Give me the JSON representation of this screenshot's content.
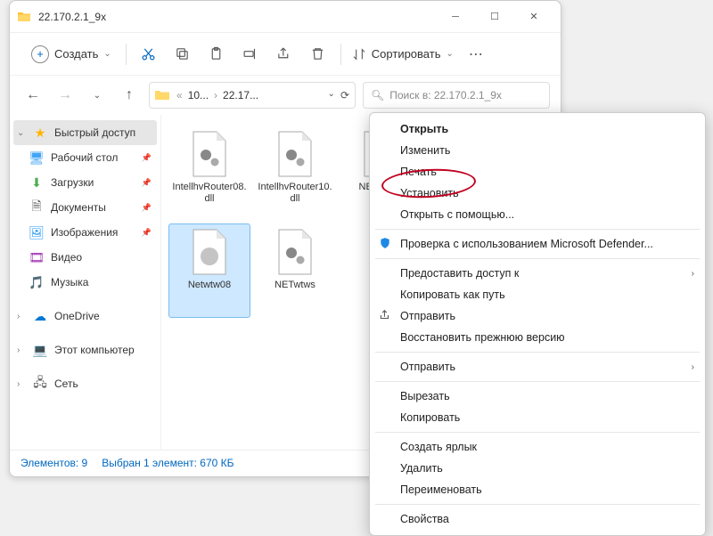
{
  "titlebar": {
    "title": "22.170.2.1_9x"
  },
  "toolbar": {
    "create_label": "Создать",
    "sort_label": "Сортировать"
  },
  "address": {
    "seg1": "10...",
    "seg2": "22.17..."
  },
  "search": {
    "placeholder": "Поиск в: 22.170.2.1_9x"
  },
  "sidebar": {
    "quick_access": "Быстрый доступ",
    "desktop": "Рабочий стол",
    "downloads": "Загрузки",
    "documents": "Документы",
    "pictures": "Изображения",
    "video": "Видео",
    "music": "Музыка",
    "onedrive": "OneDrive",
    "this_pc": "Этот компьютер",
    "network": "Сеть"
  },
  "files": {
    "f0": "IntellhvRouter08.dll",
    "f1": "IntellhvRouter10.dll",
    "f2": "NETwaws",
    "f3": "netwtw08",
    "f4": "Netwtw08",
    "f5": "NETwtws"
  },
  "status": {
    "count": "Элементов: 9",
    "selection": "Выбран 1 элемент: 670 КБ"
  },
  "menu": {
    "open": "Открыть",
    "edit": "Изменить",
    "print": "Печать",
    "install": "Установить",
    "open_with": "Открыть с помощью...",
    "defender": "Проверка с использованием Microsoft Defender...",
    "give_access": "Предоставить доступ к",
    "copy_path": "Копировать как путь",
    "share": "Отправить",
    "restore": "Восстановить прежнюю версию",
    "send_to": "Отправить",
    "cut": "Вырезать",
    "copy": "Копировать",
    "create_shortcut": "Создать ярлык",
    "delete": "Удалить",
    "rename": "Переименовать",
    "properties": "Свойства"
  }
}
